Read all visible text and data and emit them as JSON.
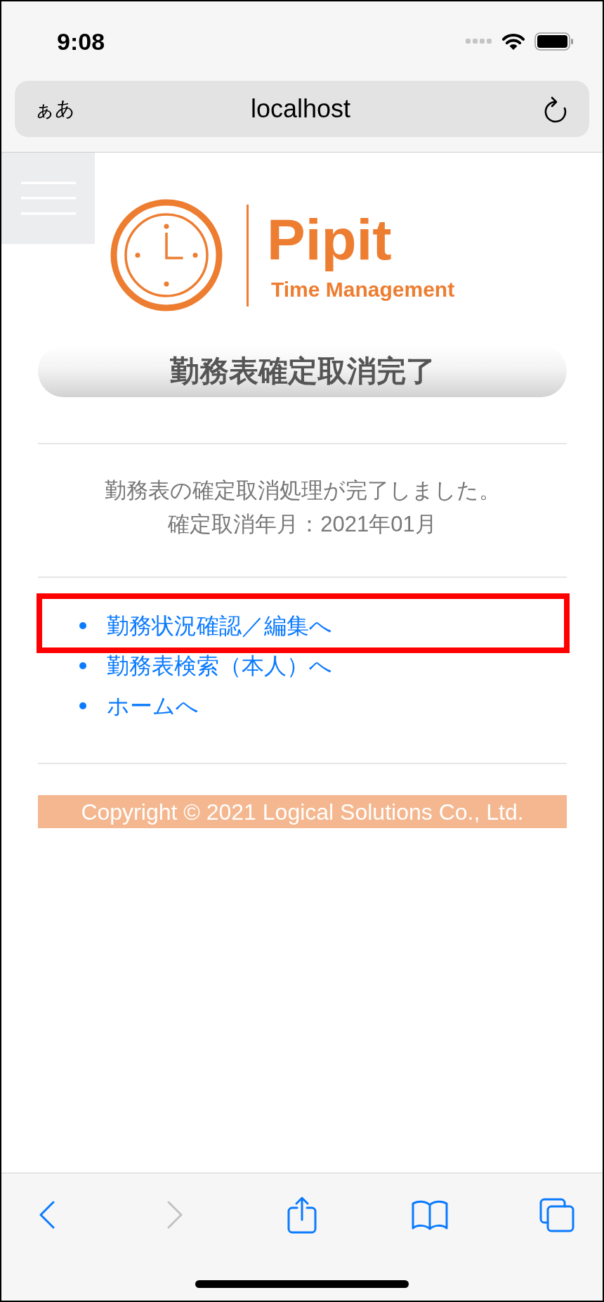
{
  "status_bar": {
    "time": "9:08"
  },
  "address_bar": {
    "text_size_button": "ぁあ",
    "url": "localhost"
  },
  "logo": {
    "name": "Pipit",
    "tagline": "Time Management"
  },
  "page_title": "勤務表確定取消完了",
  "message_lines": [
    "勤務表の確定取消処理が完了しました。",
    "確定取消年月：2021年01月"
  ],
  "links": [
    {
      "label": "勤務状況確認／編集へ",
      "highlighted": true
    },
    {
      "label": "勤務表検索（本人）へ",
      "highlighted": false
    },
    {
      "label": "ホームへ",
      "highlighted": false
    }
  ],
  "footer": {
    "copyright": "Copyright © 2021 Logical Solutions Co., Ltd."
  },
  "toolbar": [
    {
      "kind": "back",
      "disabled": false
    },
    {
      "kind": "forward",
      "disabled": true
    },
    {
      "kind": "share",
      "disabled": false
    },
    {
      "kind": "bookmarks",
      "disabled": false
    },
    {
      "kind": "tabs",
      "disabled": false
    }
  ]
}
